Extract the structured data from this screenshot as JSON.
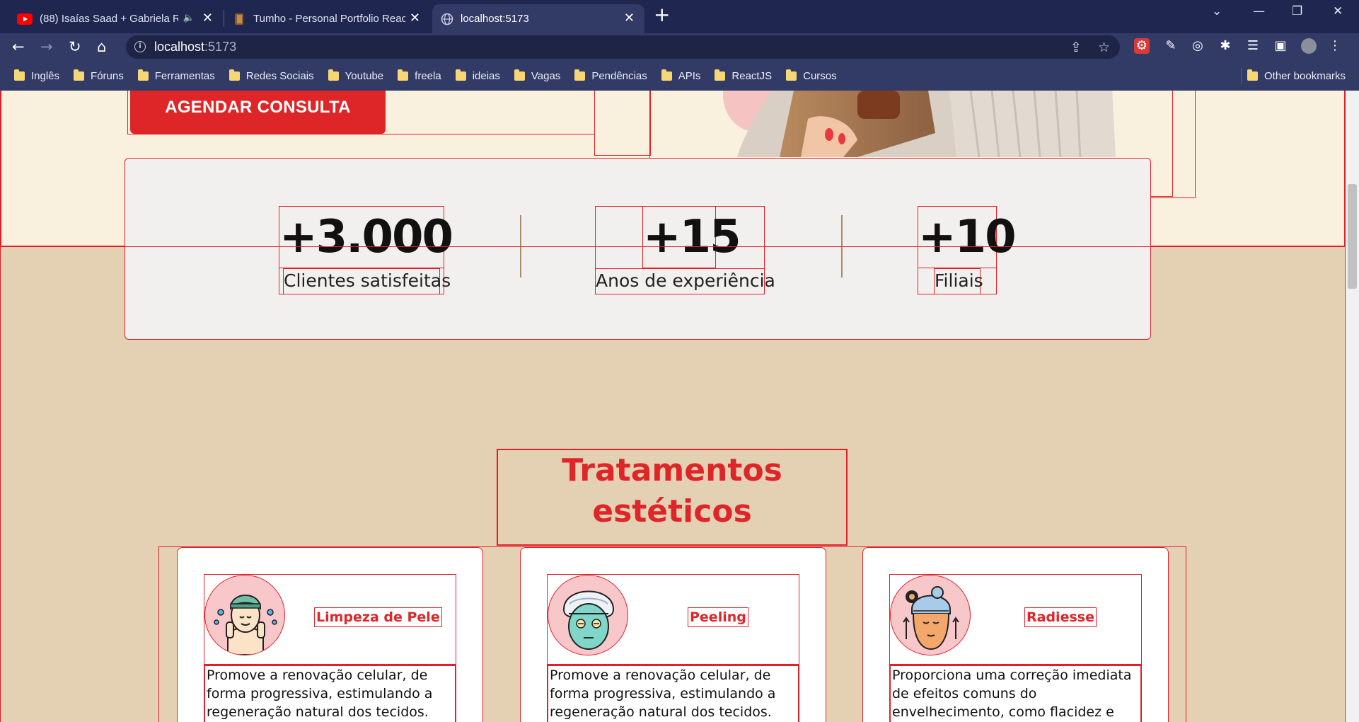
{
  "browser": {
    "tabs": [
      {
        "title": "(88) Isaías Saad + Gabriela R",
        "favicon": "youtube-icon",
        "audio": true
      },
      {
        "title": "Tumho - Personal Portfolio React",
        "favicon": "site-icon"
      },
      {
        "title": "localhost:5173",
        "favicon": "globe-icon",
        "active": true
      }
    ],
    "address": {
      "host": "localhost",
      "port": ":5173"
    },
    "bookmarks": [
      "Inglês",
      "Fóruns",
      "Ferramentas",
      "Redes Sociais",
      "Youtube",
      "freela",
      "ideias",
      "Vagas",
      "Pendências",
      "APIs",
      "ReactJS",
      "Cursos"
    ],
    "other_bookmarks": "Other bookmarks"
  },
  "hero": {
    "cta_label": "AGENDAR CONSULTA"
  },
  "stats": [
    {
      "value": "+3.000",
      "label": "Clientes satisfeitas"
    },
    {
      "value": "+15",
      "label": "Anos de experiência"
    },
    {
      "value": "+10",
      "label": "Filiais"
    }
  ],
  "treatments": {
    "title": "Tratamentos estéticos",
    "cards": [
      {
        "title": "Limpeza de Pele",
        "icon": "face-cleansing-icon",
        "description": "Promove a renovação celular, de forma progressiva, estimulando a regeneração natural dos tecidos."
      },
      {
        "title": "Peeling",
        "icon": "face-mask-icon",
        "description": "Promove a renovação celular, de forma progressiva, estimulando a regeneração natural dos tecidos."
      },
      {
        "title": "Radiesse",
        "icon": "facial-lift-icon",
        "description": "Proporciona uma correção imediata de efeitos comuns do envelhecimento, como flacidez e"
      }
    ]
  },
  "colors": {
    "accent": "#de2629",
    "hero_bg": "#f9f1dd",
    "page_bg": "#e4d0b3",
    "stats_bg": "#f1f0ee",
    "icon_bg": "#f8c7ca",
    "chrome_dark": "#1f2750",
    "chrome": "#323a66"
  }
}
